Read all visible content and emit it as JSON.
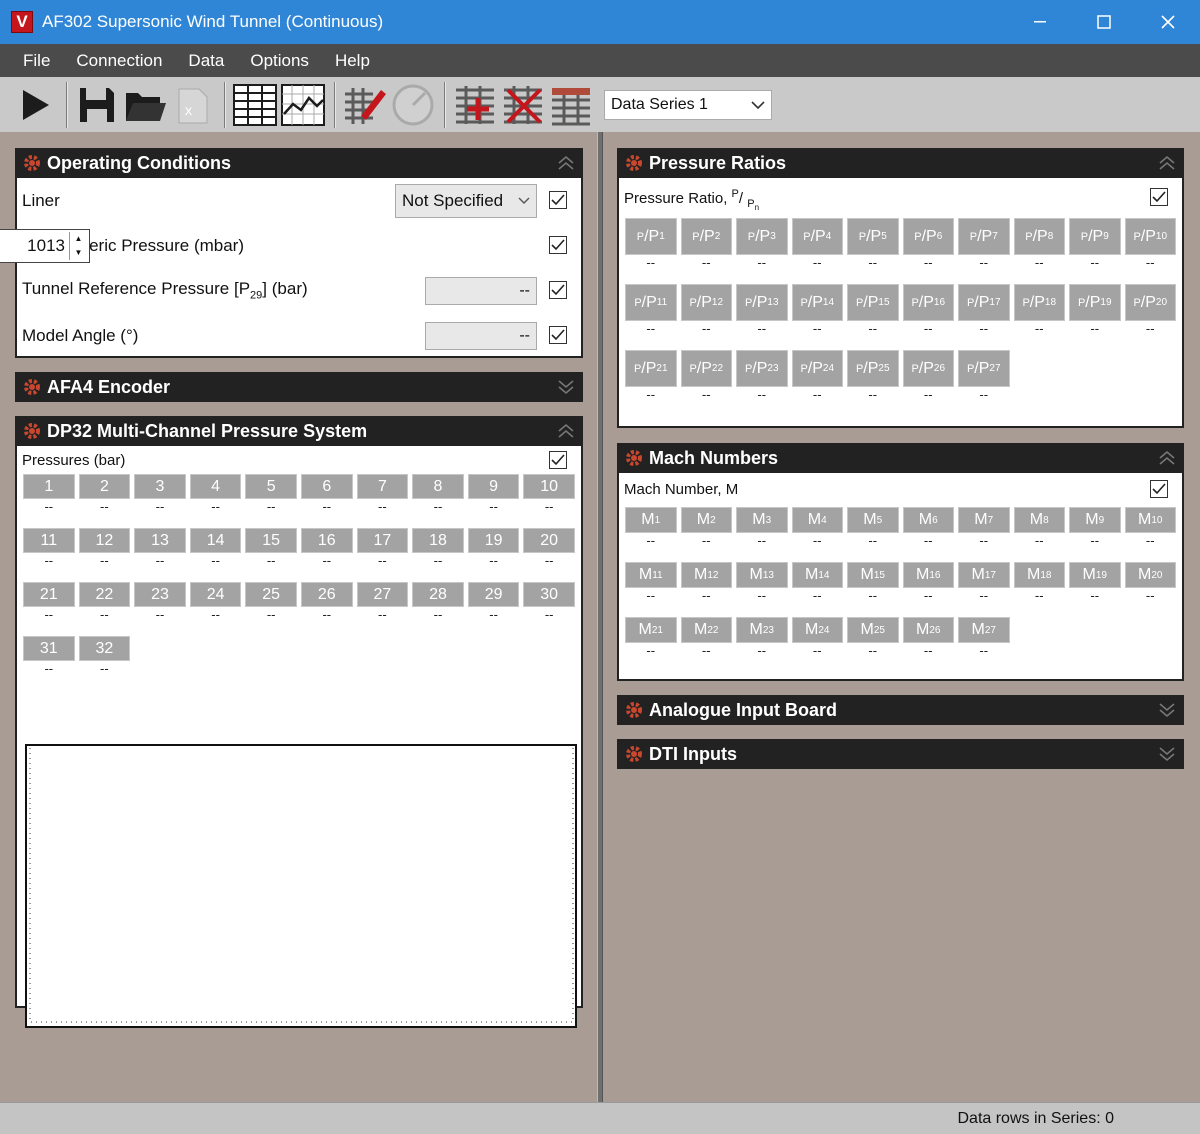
{
  "window": {
    "title": "AF302 Supersonic Wind Tunnel (Continuous)",
    "logo": "V"
  },
  "menu": [
    "File",
    "Connection",
    "Data",
    "Options",
    "Help"
  ],
  "toolbar": {
    "series_value": "Data Series 1"
  },
  "operating_conditions": {
    "title": "Operating Conditions",
    "liner_label": "Liner",
    "liner_value": "Not Specified",
    "atm_label": "Atmospheric Pressure  (mbar)",
    "atm_value": "1013",
    "tref_label_pre": "Tunnel Reference Pressure [P",
    "tref_sub": "29",
    "tref_label_post": "]  (bar)",
    "tref_value": "--",
    "angle_label": "Model Angle  (°)",
    "angle_value": "--"
  },
  "afa4": {
    "title": "AFA4 Encoder"
  },
  "dp32": {
    "title": "DP32 Multi-Channel Pressure System",
    "label": "Pressures (bar)",
    "channels": [
      "1",
      "2",
      "3",
      "4",
      "5",
      "6",
      "7",
      "8",
      "9",
      "10",
      "11",
      "12",
      "13",
      "14",
      "15",
      "16",
      "17",
      "18",
      "19",
      "20",
      "21",
      "22",
      "23",
      "24",
      "25",
      "26",
      "27",
      "28",
      "29",
      "30",
      "31",
      "32"
    ],
    "value": "--"
  },
  "pressure_ratios": {
    "title": "Pressure Ratios",
    "label": "Pressure Ratio,",
    "label_num": "P",
    "label_den": "P",
    "label_den_sub": "n",
    "chip_num": "P",
    "chip_den": "P",
    "count_labels": [
      "1",
      "2",
      "3",
      "4",
      "5",
      "6",
      "7",
      "8",
      "9",
      "10",
      "11",
      "12",
      "13",
      "14",
      "15",
      "16",
      "17",
      "18",
      "19",
      "20",
      "21",
      "22",
      "23",
      "24",
      "25",
      "26",
      "27"
    ],
    "value": "--"
  },
  "mach": {
    "title": "Mach Numbers",
    "label": "Mach Number, M",
    "chip_letter": "M",
    "count_labels": [
      "1",
      "2",
      "3",
      "4",
      "5",
      "6",
      "7",
      "8",
      "9",
      "10",
      "11",
      "12",
      "13",
      "14",
      "15",
      "16",
      "17",
      "18",
      "19",
      "20",
      "21",
      "22",
      "23",
      "24",
      "25",
      "26",
      "27"
    ],
    "value": "--"
  },
  "analogue": {
    "title": "Analogue Input Board"
  },
  "dti": {
    "title": "DTI Inputs"
  },
  "status": {
    "text": "Data rows in Series: 0"
  }
}
